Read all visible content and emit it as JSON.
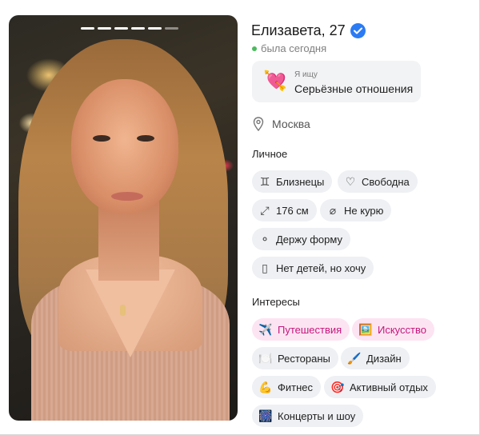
{
  "profile": {
    "name_age": "Елизавета, 27",
    "status": "была сегодня",
    "seeking_label": "Я ищу",
    "seeking_value": "Серьёзные отношения",
    "city": "Москва",
    "personal_title": "Личное",
    "interests_title": "Интересы"
  },
  "personal": [
    {
      "icon": "gemini-icon",
      "label": "Близнецы"
    },
    {
      "icon": "heart-icon",
      "label": "Свободна"
    },
    {
      "icon": "height-icon",
      "label": "176 см"
    },
    {
      "icon": "no-smoking-icon",
      "label": "Не курю"
    },
    {
      "icon": "dumbbell-icon",
      "label": "Держу форму"
    },
    {
      "icon": "baby-bottle-icon",
      "label": "Нет детей, но хочу"
    }
  ],
  "interests": [
    {
      "icon": "airplane-icon",
      "label": "Путешествия",
      "highlight": true
    },
    {
      "icon": "picture-icon",
      "label": "Искусство",
      "highlight": true
    },
    {
      "icon": "fork-knife-icon",
      "label": "Рестораны",
      "highlight": false
    },
    {
      "icon": "brush-icon",
      "label": "Дизайн",
      "highlight": false
    },
    {
      "icon": "biceps-icon",
      "label": "Фитнес",
      "highlight": false
    },
    {
      "icon": "target-icon",
      "label": "Активный отдых",
      "highlight": false
    },
    {
      "icon": "fireworks-icon",
      "label": "Концерты и шоу",
      "highlight": false
    }
  ],
  "colors": {
    "verified": "#2a7bf4",
    "online": "#4cba5e",
    "chip_bg": "#eef0f3",
    "chip_highlight_bg": "#fde4f2",
    "chip_highlight_text": "#c2187c"
  }
}
